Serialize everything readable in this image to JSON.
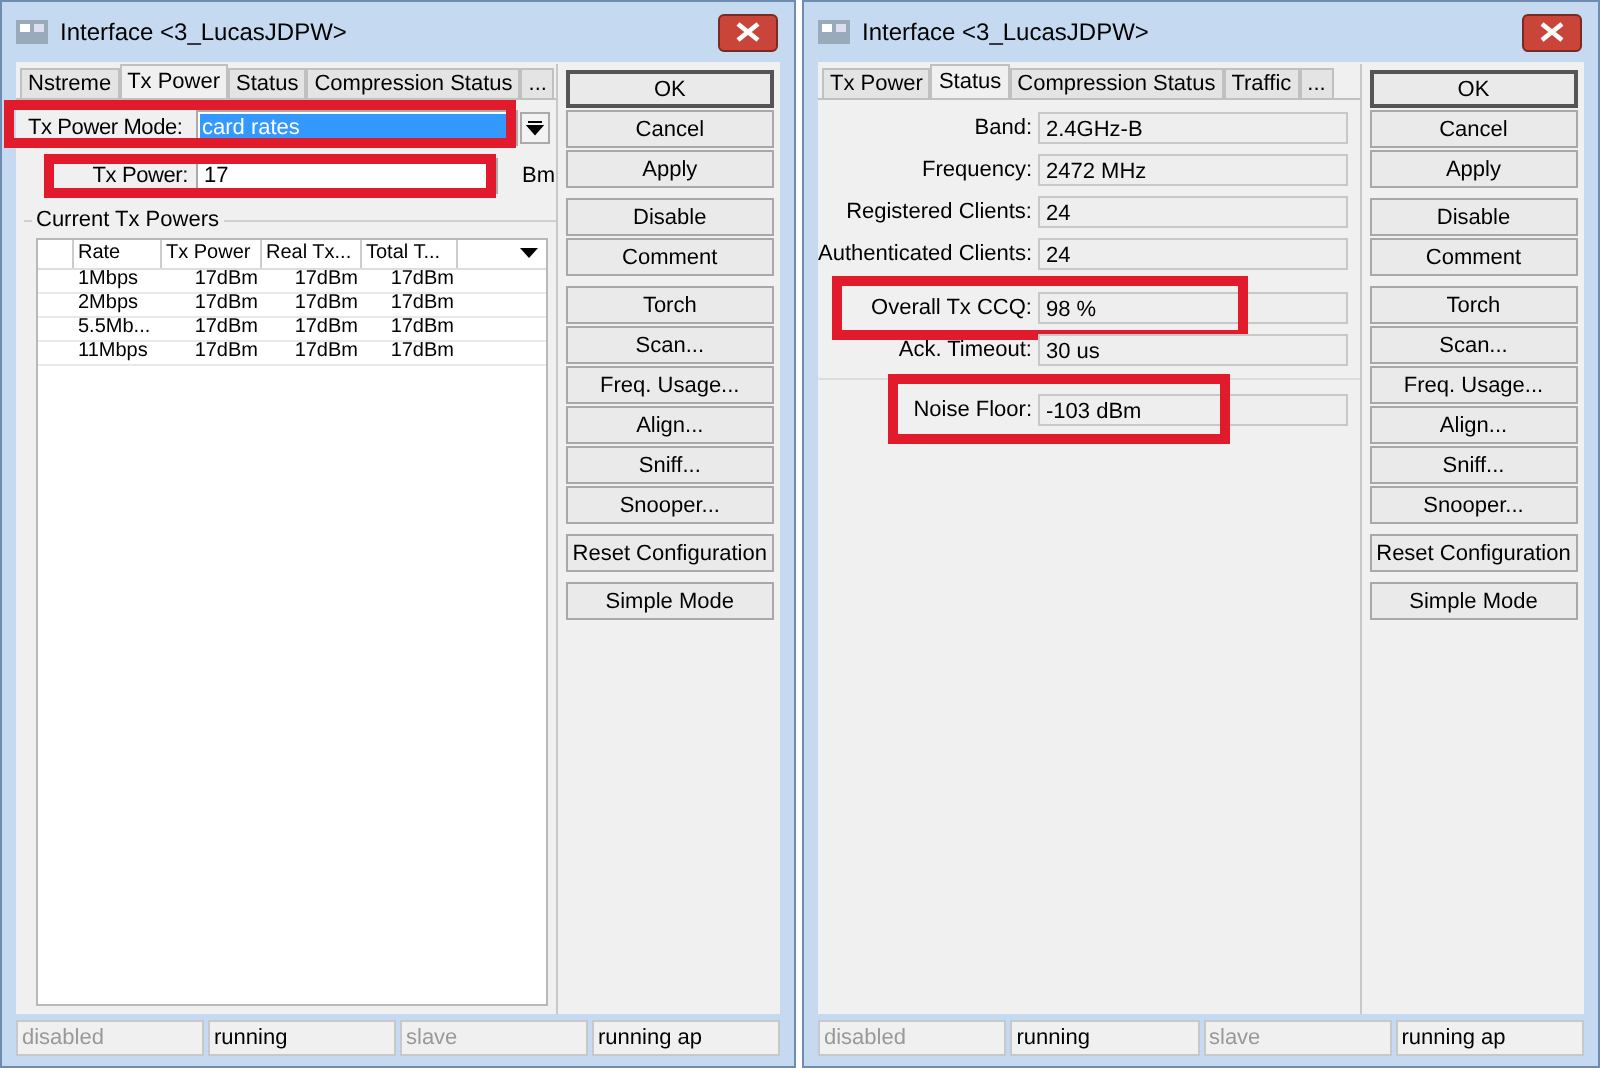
{
  "windows": [
    {
      "title": "Interface <3_LucasJDPW>",
      "tabs": [
        {
          "label": "Nstreme",
          "selected": false
        },
        {
          "label": "Tx Power",
          "selected": true
        },
        {
          "label": "Status",
          "selected": false
        },
        {
          "label": "Compression Status",
          "selected": false
        },
        {
          "label": "...",
          "selected": false
        }
      ],
      "content": {
        "kind": "txpower",
        "fields": [
          {
            "kind": "dropdown",
            "label": "Tx Power Mode:",
            "value": "card rates",
            "highlighted": true
          },
          {
            "kind": "input",
            "label": "Tx Power:",
            "value": "17",
            "unit": "Bm",
            "highlighted": true
          }
        ],
        "group": {
          "title": "Current Tx Powers",
          "columns": [
            "Rate",
            "Tx Power",
            "Real Tx...",
            "Total T..."
          ],
          "rows": [
            [
              "1Mbps",
              "17dBm",
              "17dBm",
              "17dBm"
            ],
            [
              "2Mbps",
              "17dBm",
              "17dBm",
              "17dBm"
            ],
            [
              "5.5Mb...",
              "17dBm",
              "17dBm",
              "17dBm"
            ],
            [
              "11Mbps",
              "17dBm",
              "17dBm",
              "17dBm"
            ]
          ]
        }
      },
      "buttons": [
        [
          "OK",
          "Cancel",
          "Apply"
        ],
        [
          "Disable",
          "Comment"
        ],
        [
          "Torch",
          "Scan...",
          "Freq. Usage...",
          "Align...",
          "Sniff...",
          "Snooper..."
        ],
        [
          "Reset Configuration"
        ],
        [
          "Simple Mode"
        ]
      ],
      "status_bar": [
        {
          "text": "disabled",
          "disabled": true
        },
        {
          "text": "running",
          "disabled": false
        },
        {
          "text": "slave",
          "disabled": true
        },
        {
          "text": "running ap",
          "disabled": false
        }
      ]
    },
    {
      "title": "Interface <3_LucasJDPW>",
      "tabs": [
        {
          "label": "Tx Power",
          "selected": false
        },
        {
          "label": "Status",
          "selected": true
        },
        {
          "label": "Compression Status",
          "selected": false
        },
        {
          "label": "Traffic",
          "selected": false
        },
        {
          "label": "...",
          "selected": false
        }
      ],
      "content": {
        "kind": "status",
        "fields": [
          {
            "label": "Band:",
            "value": "2.4GHz-B",
            "highlighted": false
          },
          {
            "label": "Frequency:",
            "value": "2472 MHz",
            "highlighted": false
          },
          {
            "label": "Registered Clients:",
            "value": "24",
            "highlighted": false
          },
          {
            "label": "Authenticated Clients:",
            "value": "24",
            "highlighted": false
          },
          {
            "label": "Overall Tx CCQ:",
            "value": "98 %",
            "highlighted": true
          },
          {
            "label": "Ack. Timeout:",
            "value": "30 us",
            "highlighted": false
          },
          {
            "label": "Noise Floor:",
            "value": "-103 dBm",
            "highlighted": true,
            "separated": true
          }
        ]
      },
      "buttons": [
        [
          "OK",
          "Cancel",
          "Apply"
        ],
        [
          "Disable",
          "Comment"
        ],
        [
          "Torch",
          "Scan...",
          "Freq. Usage...",
          "Align...",
          "Sniff...",
          "Snooper..."
        ],
        [
          "Reset Configuration"
        ],
        [
          "Simple Mode"
        ]
      ],
      "status_bar": [
        {
          "text": "disabled",
          "disabled": true
        },
        {
          "text": "running",
          "disabled": false
        },
        {
          "text": "slave",
          "disabled": true
        },
        {
          "text": "running ap",
          "disabled": false
        }
      ]
    }
  ]
}
